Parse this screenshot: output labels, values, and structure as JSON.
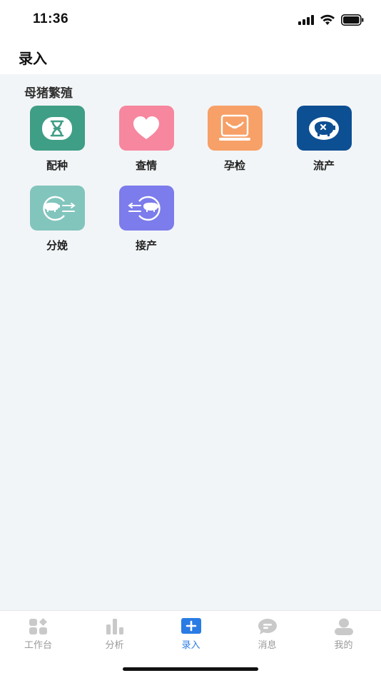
{
  "status_bar": {
    "time": "11:36"
  },
  "header": {
    "title": "录入"
  },
  "section": {
    "title": "母猪繁殖"
  },
  "items": [
    {
      "label": "配种",
      "icon": "dna-icon",
      "color": "#3f9e86"
    },
    {
      "label": "查情",
      "icon": "heart-icon",
      "color": "#f7869f"
    },
    {
      "label": "孕检",
      "icon": "ultrasound-icon",
      "color": "#f7a067"
    },
    {
      "label": "流产",
      "icon": "pig-cross-icon",
      "color": "#0d4f93"
    },
    {
      "label": "分娩",
      "icon": "pig-out-arrows-icon",
      "color": "#82c5bd"
    },
    {
      "label": "接产",
      "icon": "pig-in-arrows-icon",
      "color": "#7c7cec"
    }
  ],
  "tabbar": {
    "tabs": [
      {
        "label": "工作台",
        "icon": "workbench-icon"
      },
      {
        "label": "分析",
        "icon": "bar-chart-icon"
      },
      {
        "label": "录入",
        "icon": "plus-icon",
        "active": true
      },
      {
        "label": "消息",
        "icon": "message-icon"
      },
      {
        "label": "我的",
        "icon": "user-icon"
      }
    ]
  },
  "colors": {
    "accent": "#2a7be4",
    "inactive": "#c9c9c9",
    "background": "#f2f5f7"
  }
}
